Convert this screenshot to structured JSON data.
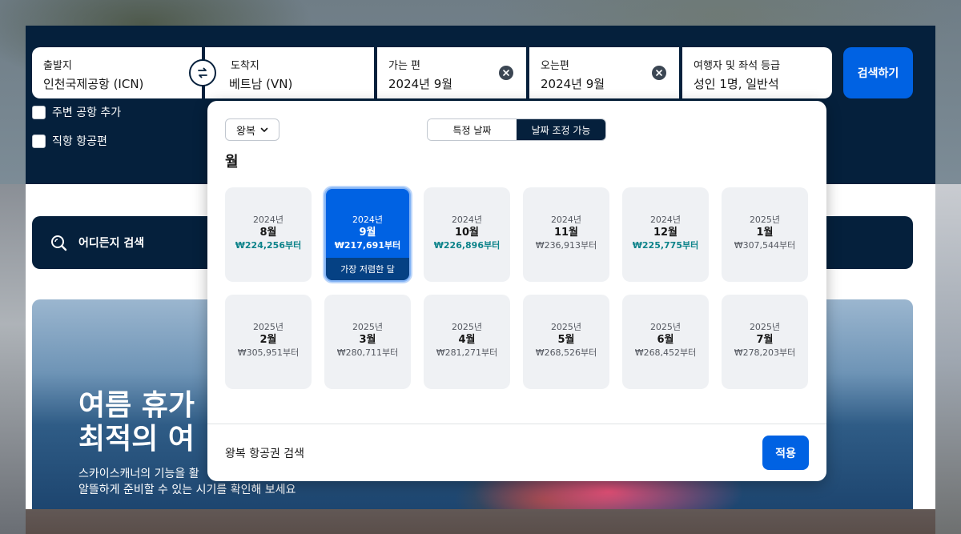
{
  "search": {
    "origin": {
      "label": "출발지",
      "value": "인천국제공항 (ICN)"
    },
    "destination": {
      "label": "도착지",
      "value": "베트남 (VN)"
    },
    "depart": {
      "label": "가는 편",
      "value": "2024년 9월"
    },
    "return": {
      "label": "오는편",
      "value": "2024년 9월"
    },
    "travellers": {
      "label": "여행자 및 좌석 등급",
      "value": "성인 1명, 일반석"
    },
    "search_button": "검색하기",
    "nearby_airports": "주변 공항 추가",
    "direct_flights": "직항 항공편"
  },
  "explore": {
    "label": "어디든지 검색"
  },
  "hero": {
    "title_line1": "여름 휴가",
    "title_line2": "최적의 여",
    "subtitle_line1": "스카이스캐너의 기능을 활",
    "subtitle_line2": "알뜰하게 준비할 수 있는 시기를 확인해 보세요"
  },
  "picker": {
    "trip_type": "왕복",
    "toggle": {
      "specific": "특정 날짜",
      "flexible": "날짜 조정 가능"
    },
    "heading": "월",
    "cheapest_badge": "가장 저렴한 달",
    "months": [
      {
        "year": "2024년",
        "month": "8월",
        "price": "₩224,256부터",
        "cheap": true,
        "selected": false
      },
      {
        "year": "2024년",
        "month": "9월",
        "price": "₩217,691부터",
        "cheap": true,
        "selected": true
      },
      {
        "year": "2024년",
        "month": "10월",
        "price": "₩226,896부터",
        "cheap": true,
        "selected": false
      },
      {
        "year": "2024년",
        "month": "11월",
        "price": "₩236,913부터",
        "cheap": false,
        "selected": false
      },
      {
        "year": "2024년",
        "month": "12월",
        "price": "₩225,775부터",
        "cheap": true,
        "selected": false
      },
      {
        "year": "2025년",
        "month": "1월",
        "price": "₩307,544부터",
        "cheap": false,
        "selected": false
      },
      {
        "year": "2025년",
        "month": "2월",
        "price": "₩305,951부터",
        "cheap": false,
        "selected": false
      },
      {
        "year": "2025년",
        "month": "3월",
        "price": "₩280,711부터",
        "cheap": false,
        "selected": false
      },
      {
        "year": "2025년",
        "month": "4월",
        "price": "₩281,271부터",
        "cheap": false,
        "selected": false
      },
      {
        "year": "2025년",
        "month": "5월",
        "price": "₩268,526부터",
        "cheap": false,
        "selected": false
      },
      {
        "year": "2025년",
        "month": "6월",
        "price": "₩268,452부터",
        "cheap": false,
        "selected": false
      },
      {
        "year": "2025년",
        "month": "7월",
        "price": "₩278,203부터",
        "cheap": false,
        "selected": false
      }
    ],
    "footer_text": "왕복 항공권 검색",
    "apply_button": "적용"
  },
  "colors": {
    "brand_dark": "#05203c",
    "accent_blue": "#0062e3",
    "cheap_price": "#0c838a"
  }
}
